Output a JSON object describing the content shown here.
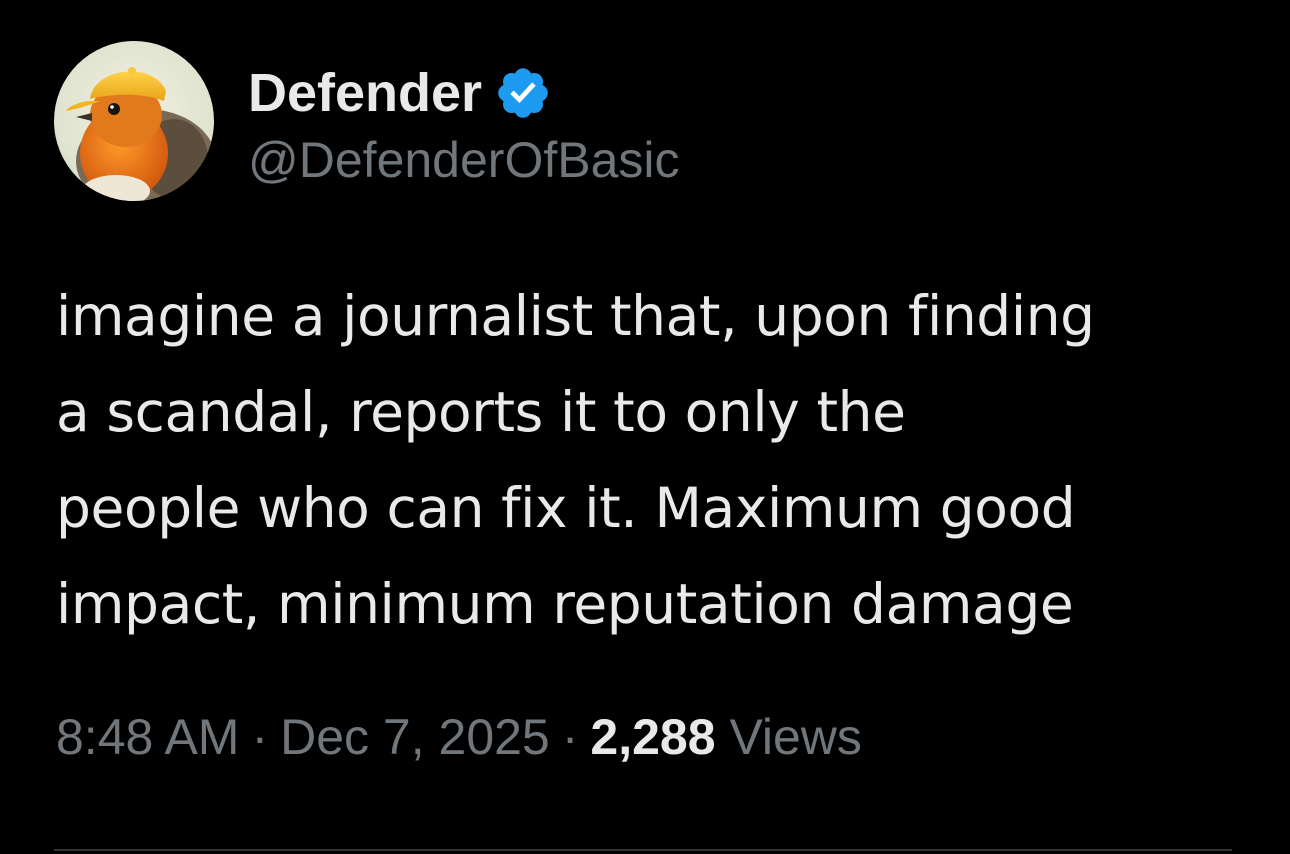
{
  "author": {
    "display_name": "Defender",
    "handle": "@DefenderOfBasic",
    "verified": true,
    "avatar_icon": "robin-bird-with-yellow-cap-avatar",
    "verified_icon": "verified-badge-icon"
  },
  "post": {
    "lines": [
      "imagine a journalist that, upon finding",
      "a scandal, reports it to only the",
      "people who can fix it. Maximum good",
      "impact, minimum reputation damage"
    ]
  },
  "meta": {
    "time": "8:48 AM",
    "separator": "·",
    "date": "Dec 7, 2025",
    "views_count": "2,288",
    "views_label": "Views"
  },
  "colors": {
    "background": "#000000",
    "primary_text": "#e7e9ea",
    "secondary_text": "#71767b",
    "verified_blue": "#1d9bf0",
    "divider": "#2f3336"
  }
}
